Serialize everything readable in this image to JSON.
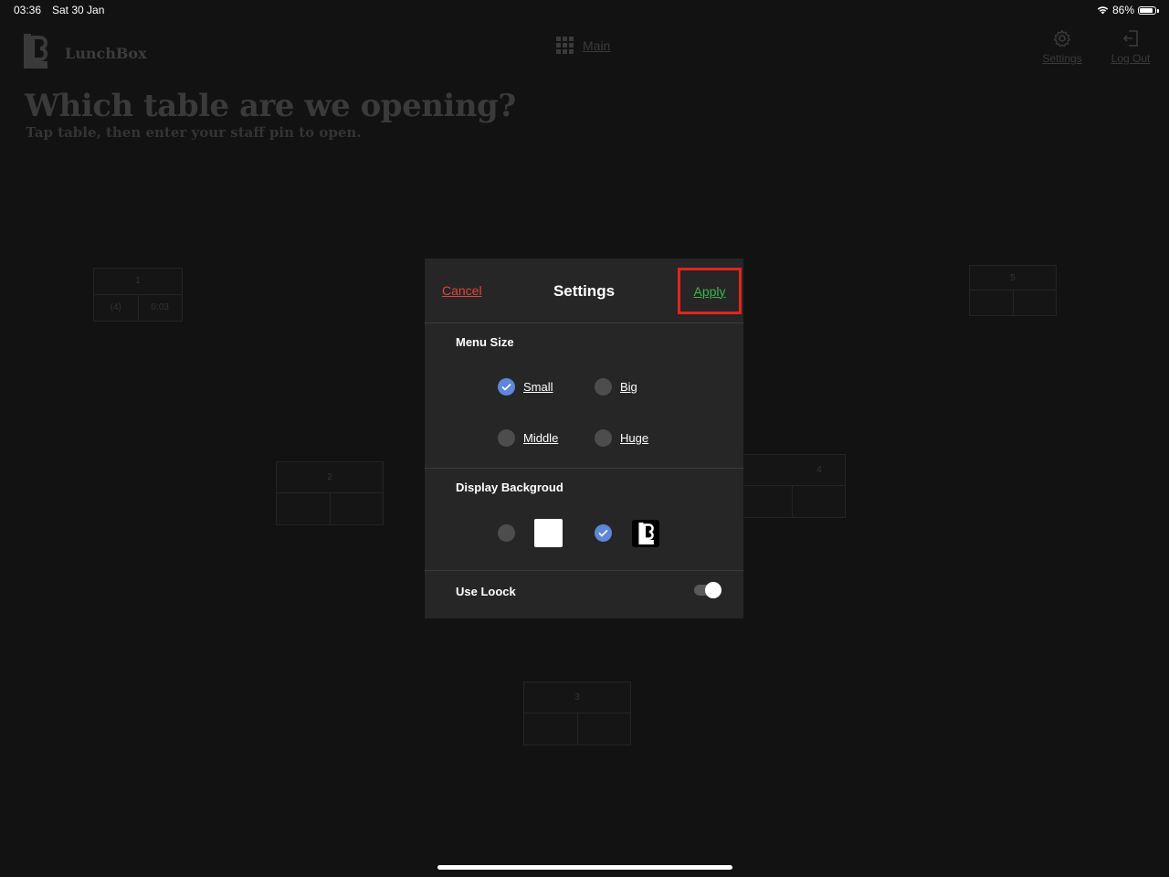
{
  "status_bar": {
    "time": "03:36",
    "date": "Sat 30 Jan",
    "battery_percent": "86%",
    "battery_level": 0.86
  },
  "app": {
    "name": "LunchBox",
    "headline": "Which table are we opening?",
    "subline": "Tap table, then enter your staff pin to open."
  },
  "nav": {
    "main_label": "Main",
    "settings_label": "Settings",
    "logout_label": "Log Out"
  },
  "tables": [
    {
      "number": "1",
      "guests": "(4)",
      "time": "0:03"
    },
    {
      "number": "2",
      "guests": "",
      "time": ""
    },
    {
      "number": "3",
      "guests": "",
      "time": ""
    },
    {
      "number": "4",
      "guests": "",
      "time": ""
    },
    {
      "number": "5",
      "guests": "",
      "time": ""
    }
  ],
  "settings_modal": {
    "cancel_label": "Cancel",
    "title": "Settings",
    "apply_label": "Apply",
    "menu_size": {
      "label": "Menu Size",
      "options": [
        {
          "label": "Small",
          "checked": true
        },
        {
          "label": "Big",
          "checked": false
        },
        {
          "label": "Middle",
          "checked": false
        },
        {
          "label": "Huge",
          "checked": false
        }
      ]
    },
    "display_background": {
      "label": "Display Backgroud",
      "selected": "logo"
    },
    "use_lock": {
      "label": "Use Loock",
      "enabled": true
    }
  },
  "colors": {
    "cancel": "#e0453a",
    "apply": "#3bb54a",
    "highlight_box": "#e3251a",
    "radio_checked": "#5f87d8"
  }
}
